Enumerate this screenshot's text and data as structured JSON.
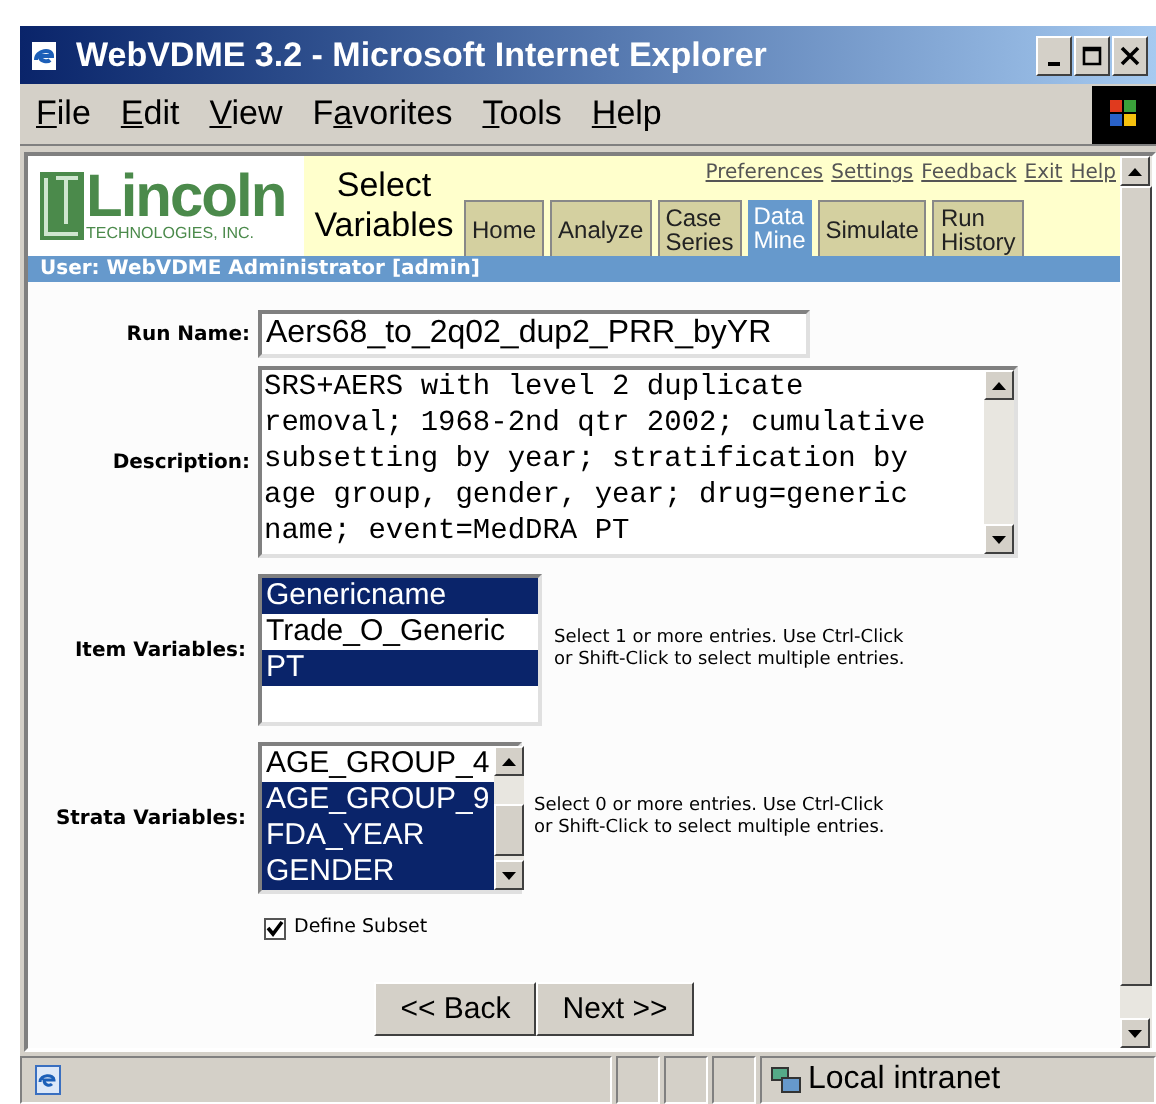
{
  "window": {
    "title": "WebVDME 3.2 - Microsoft Internet Explorer"
  },
  "menu": [
    {
      "accel": "F",
      "after": "ile"
    },
    {
      "accel": "E",
      "after": "dit"
    },
    {
      "accel": "V",
      "after": "iew"
    },
    {
      "before": "F",
      "accel": "a",
      "after": "vorites"
    },
    {
      "accel": "T",
      "after": "ools"
    },
    {
      "accel": "H",
      "after": "elp"
    }
  ],
  "header": {
    "logo": "Lincoln",
    "logo_sub": "TECHNOLOGIES, INC.",
    "page_title": [
      "Select",
      "Variables"
    ],
    "links": [
      "Preferences",
      "Settings",
      "Feedback",
      "Exit",
      "Help"
    ],
    "tabs": [
      {
        "label": [
          "Home"
        ],
        "selected": false
      },
      {
        "label": [
          "Analyze"
        ],
        "selected": false
      },
      {
        "label": [
          "Case",
          "Series"
        ],
        "selected": false
      },
      {
        "label": [
          "Data",
          "Mine"
        ],
        "selected": true
      },
      {
        "label": [
          "Simulate"
        ],
        "selected": false
      },
      {
        "label": [
          "Run",
          "History"
        ],
        "selected": false
      }
    ]
  },
  "user_bar": "User: WebVDME Administrator [admin]",
  "form": {
    "run_name": {
      "label": "Run Name:",
      "value": "Aers68_to_2q02_dup2_PRR_byYR"
    },
    "description": {
      "label": "Description:",
      "value": "SRS+AERS with level 2 duplicate removal; 1968-2nd qtr 2002; cumulative subsetting by year; stratification by age group, gender, year; drug=generic name; event=MedDRA PT"
    },
    "item_variables": {
      "label": "Item Variables:",
      "options": [
        {
          "text": "Genericname",
          "selected": true
        },
        {
          "text": "Trade_O_Generic",
          "selected": false
        },
        {
          "text": "PT",
          "selected": true
        }
      ],
      "hint": "Select 1 or more entries. Use Ctrl-Click or Shift-Click to select multiple entries."
    },
    "strata_variables": {
      "label": "Strata Variables:",
      "options": [
        {
          "text": "AGE_GROUP_4",
          "selected": false
        },
        {
          "text": "AGE_GROUP_9",
          "selected": true
        },
        {
          "text": "FDA_YEAR",
          "selected": true
        },
        {
          "text": "GENDER",
          "selected": true
        }
      ],
      "hint": "Select 0 or more entries. Use Ctrl-Click or Shift-Click to select multiple entries."
    },
    "define_subset": {
      "label": "Define Subset",
      "checked": true
    },
    "buttons": [
      "<< Back",
      "Next >>"
    ]
  },
  "status_bar": {
    "zone": "Local intranet"
  }
}
